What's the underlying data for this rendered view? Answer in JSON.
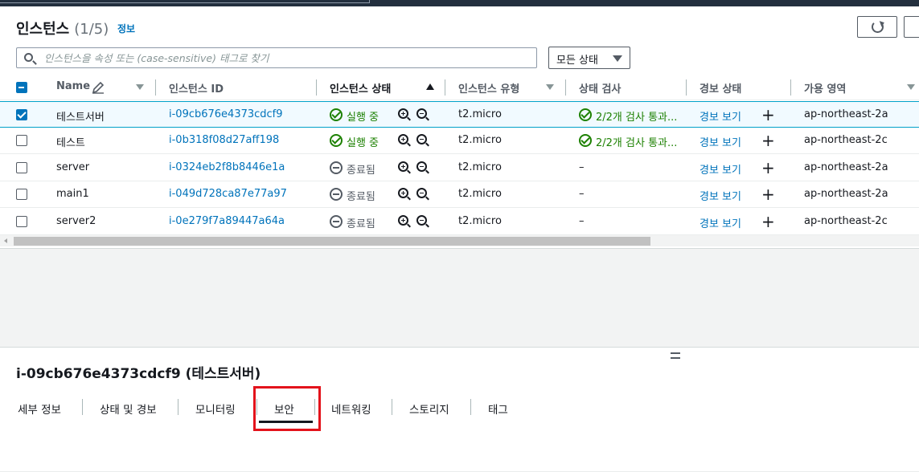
{
  "header": {
    "title": "인스턴스",
    "count": "(1/5)",
    "info_link": "정보"
  },
  "search": {
    "placeholder": "인스턴스을 속성 또는 (case-sensitive) 태그로 찾기"
  },
  "state_filter": {
    "selected": "모든 상태"
  },
  "columns": {
    "name": "Name",
    "instance_id": "인스턴스 ID",
    "instance_state": "인스턴스 상태",
    "instance_type": "인스턴스 유형",
    "status_check": "상태 검사",
    "alarm_status": "경보 상태",
    "availability_zone": "가용 영역"
  },
  "rows": [
    {
      "name": "테스트서버",
      "id": "i-09cb676e4373cdcf9",
      "state": "실행 중",
      "type": "t2.micro",
      "check": "2/2개 검사 통과...",
      "alarm": "경보 보기",
      "zone": "ap-northeast-2a",
      "selected": true
    },
    {
      "name": "테스트",
      "id": "i-0b318f08d27aff198",
      "state": "실행 중",
      "type": "t2.micro",
      "check": "2/2개 검사 통과...",
      "alarm": "경보 보기",
      "zone": "ap-northeast-2c",
      "selected": false
    },
    {
      "name": "server",
      "id": "i-0324eb2f8b8446e1a",
      "state": "종료됨",
      "type": "t2.micro",
      "check": "–",
      "alarm": "경보 보기",
      "zone": "ap-northeast-2a",
      "selected": false
    },
    {
      "name": "main1",
      "id": "i-049d728ca87e77a97",
      "state": "종료됨",
      "type": "t2.micro",
      "check": "–",
      "alarm": "경보 보기",
      "zone": "ap-northeast-2a",
      "selected": false
    },
    {
      "name": "server2",
      "id": "i-0e279f7a89447a64a",
      "state": "종료됨",
      "type": "t2.micro",
      "check": "–",
      "alarm": "경보 보기",
      "zone": "ap-northeast-2c",
      "selected": false
    }
  ],
  "detail": {
    "title": "i-09cb676e4373cdcf9 (테스트서버)",
    "tabs": [
      "세부 정보",
      "상태 및 경보",
      "모니터링",
      "보안",
      "네트워킹",
      "스토리지",
      "태그"
    ],
    "active_tab": "보안"
  },
  "colors": {
    "link": "#0073bb",
    "success": "#1d8102",
    "highlight": "#e3131b"
  }
}
